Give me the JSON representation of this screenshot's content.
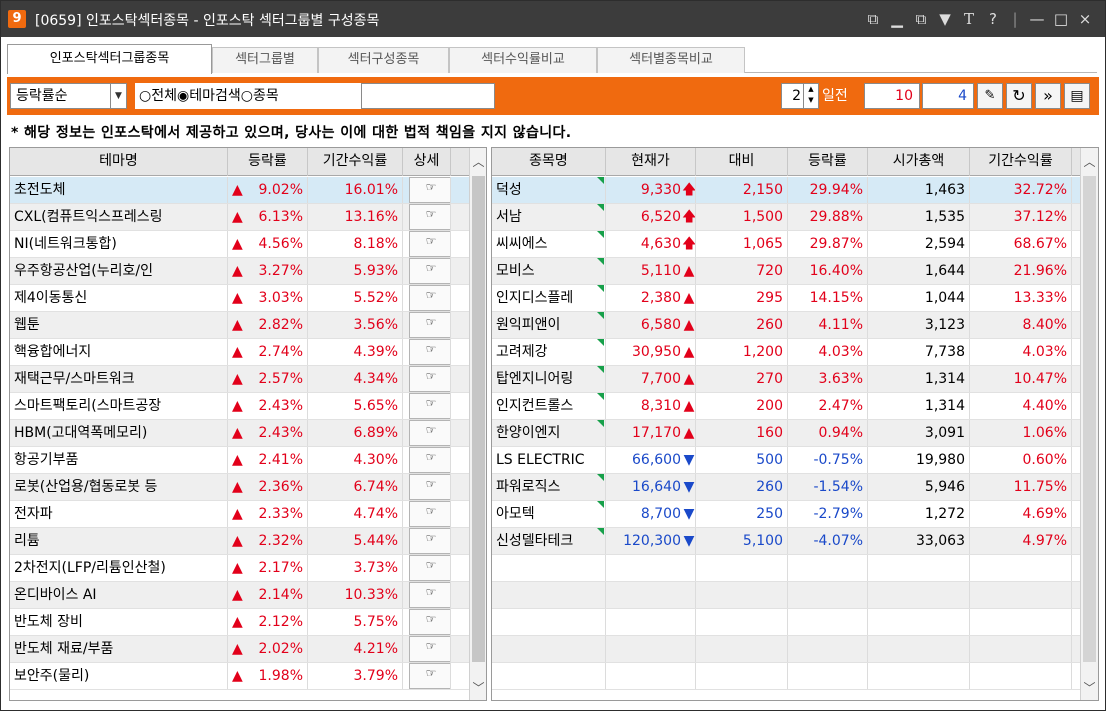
{
  "window": {
    "icon_label": "9",
    "title": "[0659] 인포스탁섹터종목 - 인포스탁 섹터그룹별 구성종목",
    "controls": [
      "⧉",
      "▁",
      "⧉",
      "▼",
      "T",
      "?",
      "|",
      "—",
      "□",
      "×"
    ]
  },
  "tabs": [
    "인포스탁섹터그룹종목",
    "섹터그룹별",
    "섹터구성종목",
    "섹터수익률비교",
    "섹터별종목비교"
  ],
  "toolbar": {
    "sort_value": "등락률순",
    "radio_all": "전체",
    "radio_theme": "테마검색",
    "radio_stock": "종목",
    "search_value": "",
    "days_value": "2",
    "days_label": "일전",
    "param1": "10",
    "param2": "4"
  },
  "notice": "* 해당 정보는 인포스탁에서 제공하고 있으며, 당사는 이에 대한 법적 책임을 지지 않습니다.",
  "left_table": {
    "columns": [
      "테마명",
      "등락률",
      "기간수익률",
      "상세"
    ],
    "detail_icon": "☞",
    "rows": [
      {
        "name": "초전도체",
        "change": "9.02%",
        "period": "16.01%"
      },
      {
        "name": "CXL(컴퓨트익스프레스링",
        "change": "6.13%",
        "period": "13.16%"
      },
      {
        "name": "NI(네트워크통합)",
        "change": "4.56%",
        "period": "8.18%"
      },
      {
        "name": "우주항공산업(누리호/인",
        "change": "3.27%",
        "period": "5.93%"
      },
      {
        "name": "제4이동통신",
        "change": "3.03%",
        "period": "5.52%"
      },
      {
        "name": "웹툰",
        "change": "2.82%",
        "period": "3.56%"
      },
      {
        "name": "핵융합에너지",
        "change": "2.74%",
        "period": "4.39%"
      },
      {
        "name": "재택근무/스마트워크",
        "change": "2.57%",
        "period": "4.34%"
      },
      {
        "name": "스마트팩토리(스마트공장",
        "change": "2.43%",
        "period": "5.65%"
      },
      {
        "name": "HBM(고대역폭메모리)",
        "change": "2.43%",
        "period": "6.89%"
      },
      {
        "name": "항공기부품",
        "change": "2.41%",
        "period": "4.30%"
      },
      {
        "name": "로봇(산업용/협동로봇 등",
        "change": "2.36%",
        "period": "6.74%"
      },
      {
        "name": "전자파",
        "change": "2.33%",
        "period": "4.74%"
      },
      {
        "name": "리튬",
        "change": "2.32%",
        "period": "5.44%"
      },
      {
        "name": "2차전지(LFP/리튬인산철)",
        "change": "2.17%",
        "period": "3.73%"
      },
      {
        "name": "온디바이스 AI",
        "change": "2.14%",
        "period": "10.33%"
      },
      {
        "name": "반도체 장비",
        "change": "2.12%",
        "period": "5.75%"
      },
      {
        "name": "반도체 재료/부품",
        "change": "2.02%",
        "period": "4.21%"
      },
      {
        "name": "보안주(물리)",
        "change": "1.98%",
        "period": "3.79%"
      }
    ]
  },
  "right_table": {
    "columns": [
      "종목명",
      "현재가",
      "대비",
      "등락률",
      "시가총액",
      "기간수익률"
    ],
    "rows": [
      {
        "name": "덕성",
        "price": "9,330",
        "arrow": "🡅",
        "dir": "up",
        "diff": "2,150",
        "rate": "29.94%",
        "cap": "1,463",
        "period": "32.72%",
        "mark": true
      },
      {
        "name": "서남",
        "price": "6,520",
        "arrow": "🡅",
        "dir": "up",
        "diff": "1,500",
        "rate": "29.88%",
        "cap": "1,535",
        "period": "37.12%",
        "mark": true
      },
      {
        "name": "씨씨에스",
        "price": "4,630",
        "arrow": "🡅",
        "dir": "up",
        "diff": "1,065",
        "rate": "29.87%",
        "cap": "2,594",
        "period": "68.67%",
        "mark": true
      },
      {
        "name": "모비스",
        "price": "5,110",
        "arrow": "▲",
        "dir": "up",
        "diff": "720",
        "rate": "16.40%",
        "cap": "1,644",
        "period": "21.96%",
        "mark": true
      },
      {
        "name": "인지디스플레",
        "price": "2,380",
        "arrow": "▲",
        "dir": "up",
        "diff": "295",
        "rate": "14.15%",
        "cap": "1,044",
        "period": "13.33%",
        "mark": true
      },
      {
        "name": "원익피앤이",
        "price": "6,580",
        "arrow": "▲",
        "dir": "up",
        "diff": "260",
        "rate": "4.11%",
        "cap": "3,123",
        "period": "8.40%",
        "mark": true
      },
      {
        "name": "고려제강",
        "price": "30,950",
        "arrow": "▲",
        "dir": "up",
        "diff": "1,200",
        "rate": "4.03%",
        "cap": "7,738",
        "period": "4.03%",
        "mark": true
      },
      {
        "name": "탑엔지니어링",
        "price": "7,700",
        "arrow": "▲",
        "dir": "up",
        "diff": "270",
        "rate": "3.63%",
        "cap": "1,314",
        "period": "10.47%",
        "mark": true
      },
      {
        "name": "인지컨트롤스",
        "price": "8,310",
        "arrow": "▲",
        "dir": "up",
        "diff": "200",
        "rate": "2.47%",
        "cap": "1,314",
        "period": "4.40%",
        "mark": true
      },
      {
        "name": "한양이엔지",
        "price": "17,170",
        "arrow": "▲",
        "dir": "up",
        "diff": "160",
        "rate": "0.94%",
        "cap": "3,091",
        "period": "1.06%",
        "mark": true
      },
      {
        "name": "LS ELECTRIC",
        "price": "66,600",
        "arrow": "▼",
        "dir": "down",
        "diff": "500",
        "rate": "-0.75%",
        "cap": "19,980",
        "period": "0.60%",
        "mark": false
      },
      {
        "name": "파워로직스",
        "price": "16,640",
        "arrow": "▼",
        "dir": "down",
        "diff": "260",
        "rate": "-1.54%",
        "cap": "5,946",
        "period": "11.75%",
        "mark": true
      },
      {
        "name": "아모텍",
        "price": "8,700",
        "arrow": "▼",
        "dir": "down",
        "diff": "250",
        "rate": "-2.79%",
        "cap": "1,272",
        "period": "4.69%",
        "mark": true
      },
      {
        "name": "신성델타테크",
        "price": "120,300",
        "arrow": "▼",
        "dir": "down",
        "diff": "5,100",
        "rate": "-4.07%",
        "cap": "33,063",
        "period": "4.97%",
        "mark": true
      }
    ]
  },
  "colors": {
    "toolbar": "#f06a0f",
    "selected_row": "#d6eaf6",
    "alt_row": "#efefef",
    "up": "#e2001a",
    "down": "#1a49c9",
    "mark": "#17a04a"
  }
}
